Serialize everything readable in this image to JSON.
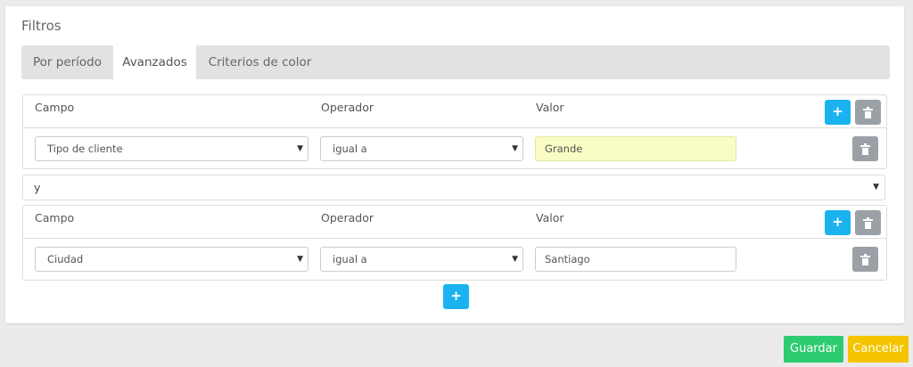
{
  "panel": {
    "title": "Filtros"
  },
  "tabs": [
    {
      "label": "Por período",
      "active": false
    },
    {
      "label": "Avanzados",
      "active": true
    },
    {
      "label": "Criterios de color",
      "active": false
    }
  ],
  "headers": {
    "campo": "Campo",
    "operador": "Operador",
    "valor": "Valor"
  },
  "groups": [
    {
      "campo": "Tipo de cliente",
      "operador": "igual a",
      "valor": "Grande"
    },
    {
      "campo": "Ciudad",
      "operador": "igual a",
      "valor": "Santiago"
    }
  ],
  "connector": {
    "value": "y"
  },
  "icons": {
    "add": "+",
    "add_name": "plus-icon",
    "delete_name": "trash-icon"
  },
  "footer": {
    "save_label": "Guardar",
    "cancel_label": "Cancelar"
  },
  "colors": {
    "add_button": "#1ab3f0",
    "delete_button": "#9aa0a6",
    "highlight_input": "#fafcc6",
    "save_button": "#2ecc71",
    "cancel_button": "#f5c400"
  }
}
